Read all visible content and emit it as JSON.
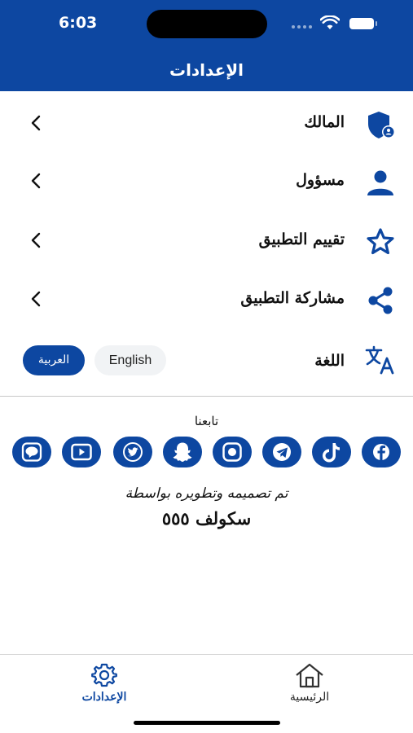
{
  "status_bar": {
    "time": "6:03"
  },
  "header": {
    "title": "الإعدادات"
  },
  "settings": {
    "items": [
      {
        "label": "المالك",
        "icon": "shield-user-icon"
      },
      {
        "label": "مسؤول",
        "icon": "person-icon"
      },
      {
        "label": "تقييم التطبيق",
        "icon": "star-icon"
      },
      {
        "label": "مشاركة التطبيق",
        "icon": "share-icon"
      }
    ],
    "language": {
      "label": "اللغة",
      "icon": "translate-icon",
      "options": [
        "English",
        "العربية"
      ],
      "selected": "العربية"
    }
  },
  "follow": {
    "title": "تابعنا",
    "icons": [
      "facebook-icon",
      "tiktok-icon",
      "telegram-icon",
      "messenger-icon",
      "snapchat-icon",
      "twitter-icon",
      "youtube-icon",
      "line-icon"
    ]
  },
  "credits": {
    "line": "تم تصميمه وتطويره بواسطة",
    "name": "سكولف ٥٥٥"
  },
  "tabbar": {
    "tabs": [
      {
        "label": "الإعدادات",
        "icon": "gear-icon",
        "active": true
      },
      {
        "label": "الرئيسية",
        "icon": "home-icon",
        "active": false
      }
    ]
  },
  "colors": {
    "primary": "#0d47a1",
    "text": "#111111",
    "pill_inactive": "#f1f3f5"
  }
}
